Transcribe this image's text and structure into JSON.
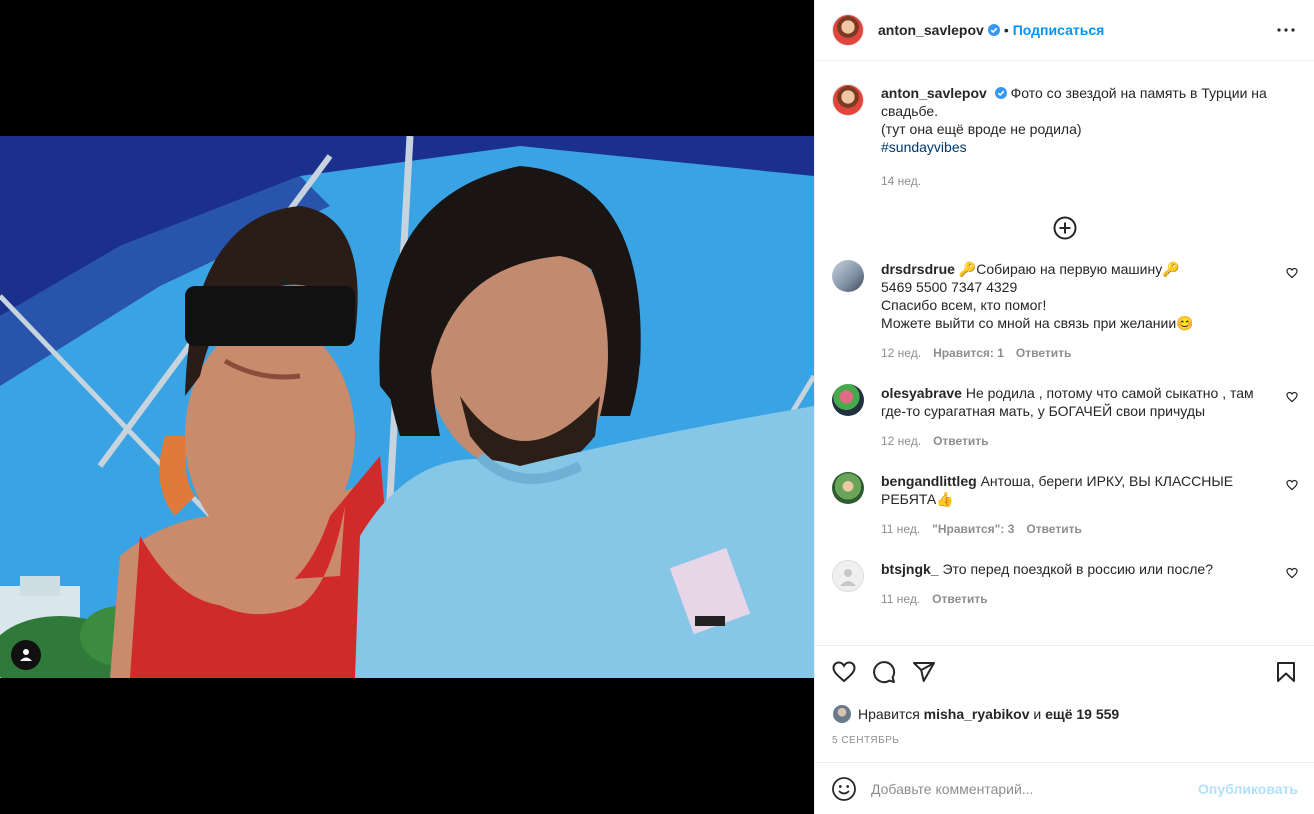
{
  "post": {
    "username": "anton_savlepov",
    "follow_label": "Подписаться",
    "dot": "•",
    "caption_text": "Фото со звездой на память в Турции на свадьбе.\n(тут она ещё вроде не родила)",
    "hashtag": "#sundayvibes",
    "caption_time": "14 нед."
  },
  "comments": [
    {
      "user": "drsdrsdrue",
      "text": "🔑Собираю на первую машину🔑\n5469 5500 7347 4329\nСпасибо всем, кто помог!\nМожете выйти со мной на связь при желании😊",
      "time": "12 нед.",
      "likes": "Нравится: 1",
      "reply": "Ответить"
    },
    {
      "user": "olesyabrave",
      "text": "Не родила , потому что самой сыкатно , там где-то сурагатная мать, у БОГАЧЕЙ свои причуды",
      "time": "12 нед.",
      "likes": "",
      "reply": "Ответить"
    },
    {
      "user": "bengandlittleg",
      "text": "Антоша, береги ИРКУ, ВЫ КЛАССНЫЕ РЕБЯТА👍",
      "time": "11 нед.",
      "likes": "\"Нравится\": 3",
      "reply": "Ответить"
    },
    {
      "user": "btsjngk_",
      "text": "Это перед поездкой в россию или после?",
      "time": "11 нед.",
      "likes": "",
      "reply": "Ответить"
    }
  ],
  "likes": {
    "prefix": "Нравится",
    "user": "misha_ryabikov",
    "middle": "и",
    "rest": "ещё 19 559"
  },
  "date": "5 сентябрь",
  "add_comment": {
    "placeholder": "Добавьте комментарий...",
    "publish_label": "Опубликовать"
  },
  "colors": {
    "accent": "#0095f6",
    "hashtag": "#00376b",
    "muted": "#8e8e8e"
  }
}
